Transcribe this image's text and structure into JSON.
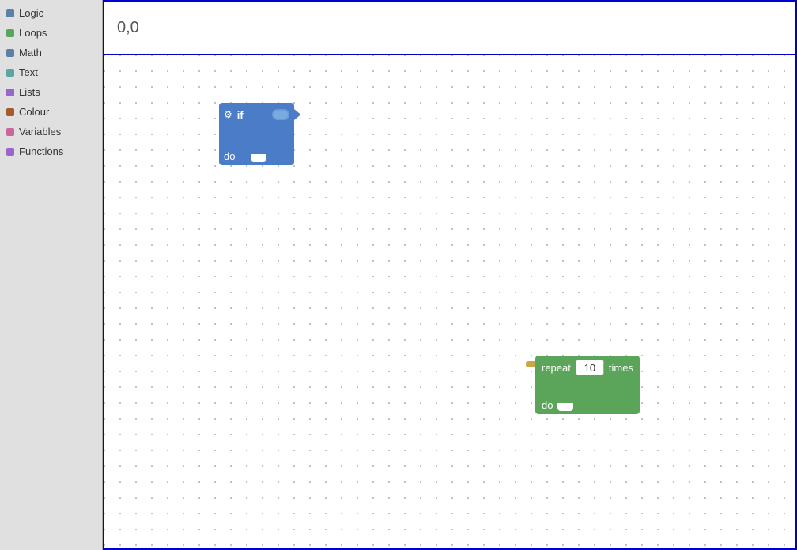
{
  "sidebar": {
    "items": [
      {
        "id": "logic",
        "label": "Logic",
        "color": "#5c81a6"
      },
      {
        "id": "loops",
        "label": "Loops",
        "color": "#5ba55b"
      },
      {
        "id": "math",
        "label": "Math",
        "color": "#5c81a6"
      },
      {
        "id": "text",
        "label": "Text",
        "color": "#5ba5a5"
      },
      {
        "id": "lists",
        "label": "Lists",
        "color": "#9966cc"
      },
      {
        "id": "colour",
        "label": "Colour",
        "color": "#a55b2e"
      },
      {
        "id": "variables",
        "label": "Variables",
        "color": "#cc6699"
      },
      {
        "id": "functions",
        "label": "Functions",
        "color": "#9966cc"
      }
    ]
  },
  "toolbar": {
    "coordinates": "0,0"
  },
  "blocks": {
    "if_block": {
      "if_label": "if",
      "do_label": "do"
    },
    "repeat_block": {
      "repeat_label": "repeat",
      "times_label": "times",
      "value": "10",
      "do_label": "do"
    }
  }
}
